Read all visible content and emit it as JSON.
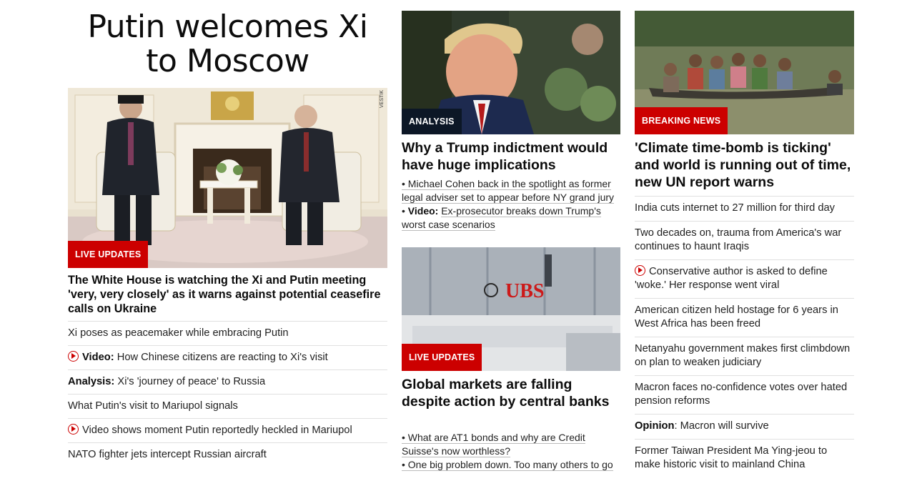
{
  "hero": {
    "headline": "Putin welcomes Xi to Moscow",
    "badge": "LIVE UPDATES",
    "watermark": "VESTIK",
    "lead": "The White House is watching the Xi and Putin meeting 'very, very closely' as it warns against potential ceasefire calls on Ukraine",
    "links": [
      {
        "prefix": "",
        "text": "Xi poses as peacemaker while embracing Putin",
        "video": false
      },
      {
        "prefix": "Video:",
        "text": "How Chinese citizens are reacting to Xi's visit",
        "video": true
      },
      {
        "prefix": "Analysis:",
        "text": "Xi's 'journey of peace' to Russia",
        "video": false
      },
      {
        "prefix": "",
        "text": "What Putin's visit to Mariupol signals",
        "video": false
      },
      {
        "prefix": "",
        "text": "Video shows moment Putin reportedly heckled in Mariupol",
        "video": true
      },
      {
        "prefix": "",
        "text": "NATO fighter jets intercept Russian aircraft",
        "video": false
      }
    ]
  },
  "trump": {
    "badge": "ANALYSIS",
    "lead": "Why a Trump indictment would have huge implications",
    "bullet": "•",
    "sub1": "Michael Cohen back in the spotlight as former legal adviser set to appear before NY grand jury",
    "sub2_prefix": "Video:",
    "sub2": "Ex-prosecutor breaks down Trump's worst case scenarios"
  },
  "markets": {
    "badge": "LIVE UPDATES",
    "sign": "UBS",
    "lead": "Global markets are falling despite action by central banks",
    "bullet": "•",
    "sub1": "What are AT1 bonds and why are Credit Suisse's now worthless?",
    "sub2": "One big problem down. Too many others to go"
  },
  "climate": {
    "badge": "BREAKING NEWS",
    "lead": "'Climate time-bomb is ticking' and world is running out of time, new UN report warns",
    "links": [
      {
        "prefix": "",
        "text": "India cuts internet to 27 million for third day",
        "video": false
      },
      {
        "prefix": "",
        "text": "Two decades on, trauma from America's war continues to haunt Iraqis",
        "video": false
      },
      {
        "prefix": "",
        "text": "Conservative author is asked to define 'woke.' Her response went viral",
        "video": true
      },
      {
        "prefix": "",
        "text": "American citizen held hostage for 6 years in West Africa has been freed",
        "video": false
      },
      {
        "prefix": "",
        "text": "Netanyahu government makes first climbdown on plan to weaken judiciary",
        "video": false
      },
      {
        "prefix": "",
        "text": "Macron faces no-confidence votes over hated pension reforms",
        "video": false
      },
      {
        "prefix": "Opinion",
        "text": ": Macron will survive",
        "video": false
      },
      {
        "prefix": "",
        "text": "Former Taiwan President Ma Ying-jeou to make historic visit to mainland China",
        "video": false
      }
    ]
  },
  "colors": {
    "red": "#cc0000",
    "navy": "#0c1726",
    "text": "#0c0c0c"
  }
}
